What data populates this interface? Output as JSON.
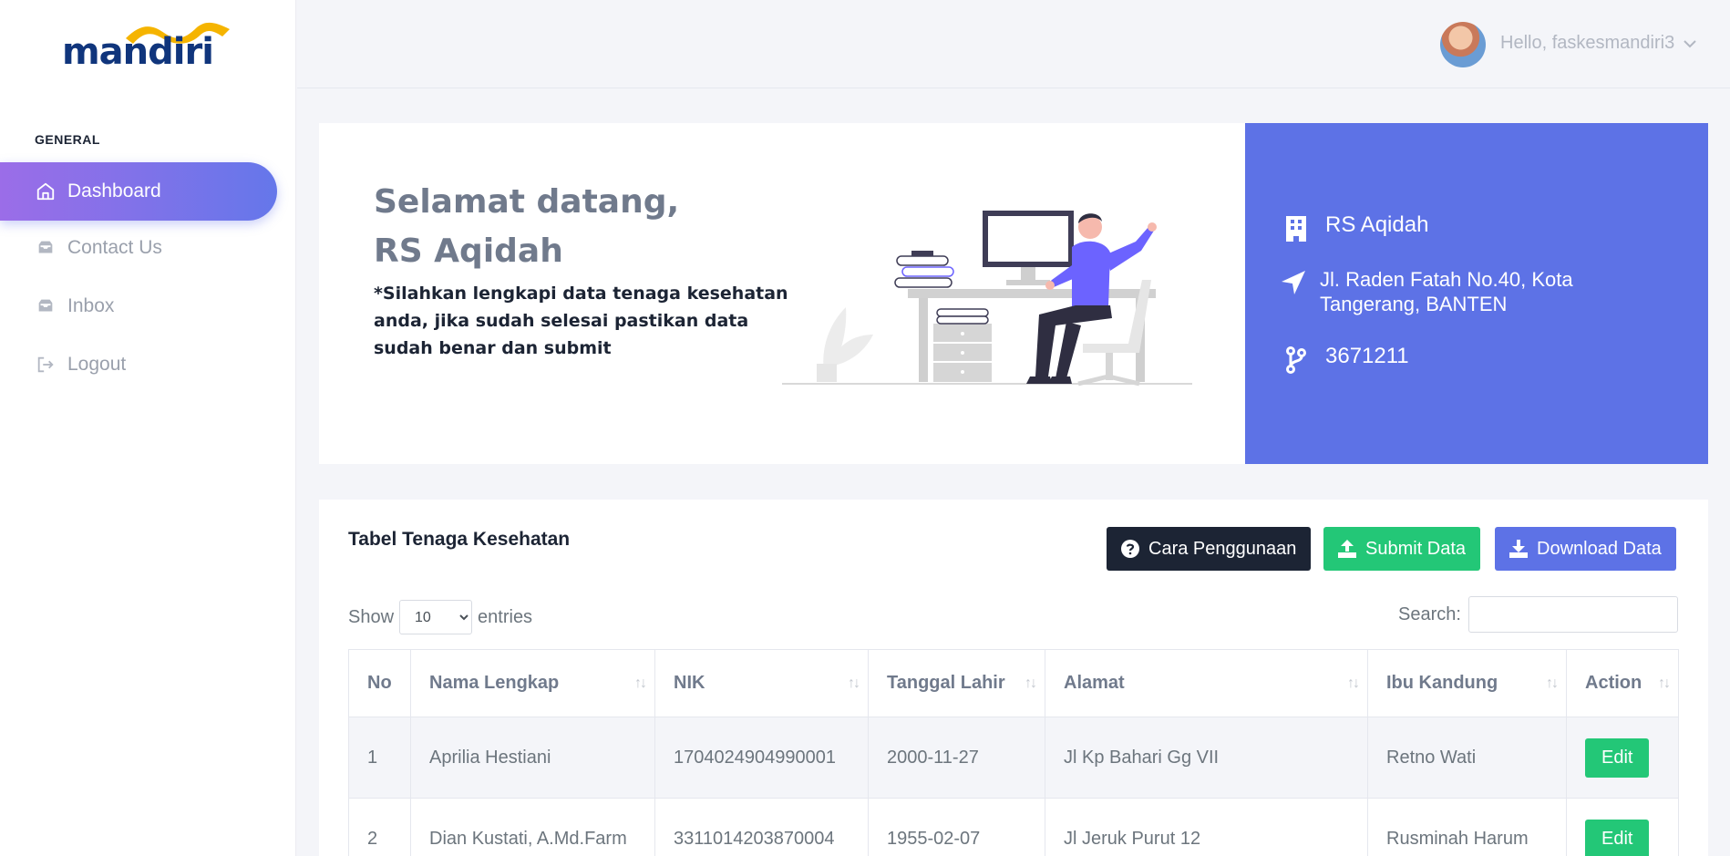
{
  "brand": {
    "logo_text": "mandiri"
  },
  "sidebar": {
    "section": "GENERAL",
    "items": [
      {
        "label": "Dashboard",
        "icon": "home-icon",
        "active": true
      },
      {
        "label": "Contact Us",
        "icon": "inbox-tray-icon",
        "active": false
      },
      {
        "label": "Inbox",
        "icon": "inbox-tray-icon",
        "active": false
      },
      {
        "label": "Logout",
        "icon": "logout-icon",
        "active": false
      }
    ]
  },
  "topbar": {
    "greeting": "Hello, faskesmandiri3"
  },
  "welcome": {
    "line1": "Selamat datang,",
    "line2": "RS Aqidah",
    "note": "*Silahkan lengkapi data tenaga kesehatan anda, jika sudah selesai pastikan data sudah benar dan submit"
  },
  "info": {
    "name": "RS Aqidah",
    "address": "Jl. Raden Fatah No.40, Kota Tangerang, BANTEN",
    "code": "3671211"
  },
  "table_card": {
    "title": "Tabel Tenaga Kesehatan",
    "buttons": {
      "guide": "Cara Penggunaan",
      "submit": "Submit Data",
      "download": "Download Data"
    },
    "show_prefix": "Show",
    "show_value": "10",
    "show_suffix": "entries",
    "search_label": "Search:",
    "columns": [
      "No",
      "Nama Lengkap",
      "NIK",
      "Tanggal Lahir",
      "Alamat",
      "Ibu Kandung",
      "Action"
    ],
    "rows": [
      {
        "no": "1",
        "nama": "Aprilia Hestiani",
        "nik": "1704024904990001",
        "tgl": "2000-11-27",
        "alamat": "Jl Kp Bahari Gg VII",
        "ibu": "Retno Wati",
        "action": "Edit"
      },
      {
        "no": "2",
        "nama": "Dian Kustati, A.Md.Farm",
        "nik": "3311014203870004",
        "tgl": "1955-02-07",
        "alamat": "Jl Jeruk Purut 12",
        "ibu": "Rusminah Harum",
        "action": "Edit"
      }
    ]
  },
  "colors": {
    "accent": "#5d72e6",
    "gradient_start": "#9b6de8",
    "success": "#23c777",
    "dark": "#1c2434",
    "brand_navy": "#10357c",
    "brand_gold": "#f5b400"
  }
}
